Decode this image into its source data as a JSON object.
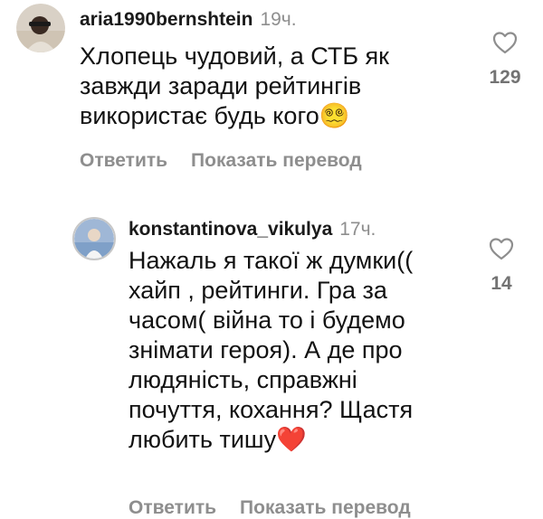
{
  "comments": [
    {
      "username": "aria1990bernshtein",
      "time": "19ч.",
      "text": "Хлопець чудовий, а СТБ як завжди заради рейтингів використає будь кого😵‍💫",
      "reply_label": "Ответить",
      "translate_label": "Показать перевод",
      "likes": "129",
      "like_icon": "heart-outline-icon"
    },
    {
      "username": "konstantinova_vikulya",
      "time": "17ч.",
      "text": "Нажаль я такої ж думки(( хайп , рейтинги. Гра за часом( війна то і будемо знімати героя). А де про людяність, справжні почуття, кохання? Щастя любить тишу❤️",
      "reply_label": "Ответить",
      "translate_label": "Показать перевод",
      "likes": "14",
      "like_icon": "heart-outline-icon"
    }
  ],
  "colors": {
    "secondary_text": "#8e8e8e",
    "primary_text": "#121212",
    "story_ring": "#c7c7c7"
  }
}
